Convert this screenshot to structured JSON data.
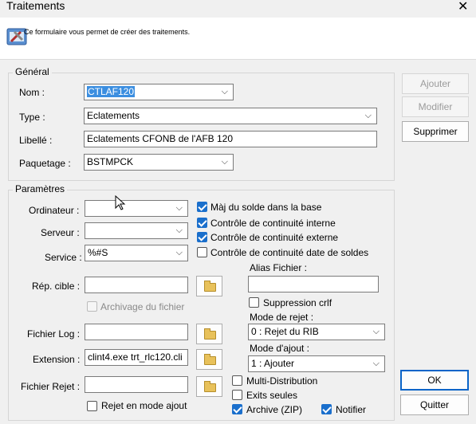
{
  "window": {
    "title": "Traitements"
  },
  "banner": {
    "text": "Ce formulaire vous permet de créer des traitements."
  },
  "general": {
    "legend": "Général",
    "nom_label": "Nom :",
    "nom_value": "CTLAF120",
    "type_label": "Type :",
    "type_value": "Eclatements",
    "libelle_label": "Libellé :",
    "libelle_value": "Eclatements CFONB de l'AFB 120",
    "paquetage_label": "Paquetage :",
    "paquetage_value": "BSTMPCK"
  },
  "actions": {
    "ajouter": "Ajouter",
    "modifier": "Modifier",
    "supprimer": "Supprimer",
    "ok": "OK",
    "quitter": "Quitter"
  },
  "params": {
    "legend": "Paramètres",
    "ordinateur_label": "Ordinateur :",
    "ordinateur_value": "",
    "serveur_label": "Serveur :",
    "serveur_value": "",
    "service_label": "Service :",
    "service_value": "%#S",
    "rep_cible_label": "Rép. cible :",
    "rep_cible_value": "",
    "archivage_label": "Archivage du fichier",
    "fichier_log_label": "Fichier Log :",
    "fichier_log_value": "",
    "extension_label": "Extension :",
    "extension_value": "clint4.exe trt_rlc120.cli",
    "fichier_rejet_label": "Fichier Rejet :",
    "fichier_rejet_value": "",
    "rejet_ajout_label": "Rejet en mode ajout",
    "cb_maj_solde": "Màj du solde dans la base",
    "cb_continuite_interne": "Contrôle de continuité interne",
    "cb_continuite_externe": "Contrôle de continuité externe",
    "cb_continuite_date": "Contrôle de continuité date de soldes",
    "alias_label": "Alias Fichier :",
    "alias_value": "",
    "suppression_crlf": "Suppression crlf",
    "mode_rejet_label": "Mode de rejet :",
    "mode_rejet_value": "0 : Rejet du RIB",
    "mode_ajout_label": "Mode d'ajout :",
    "mode_ajout_value": "1 : Ajouter",
    "multi_distribution": "Multi-Distribution",
    "exits_seules": "Exits seules",
    "archive_zip": "Archive (ZIP)",
    "notifier": "Notifier"
  }
}
